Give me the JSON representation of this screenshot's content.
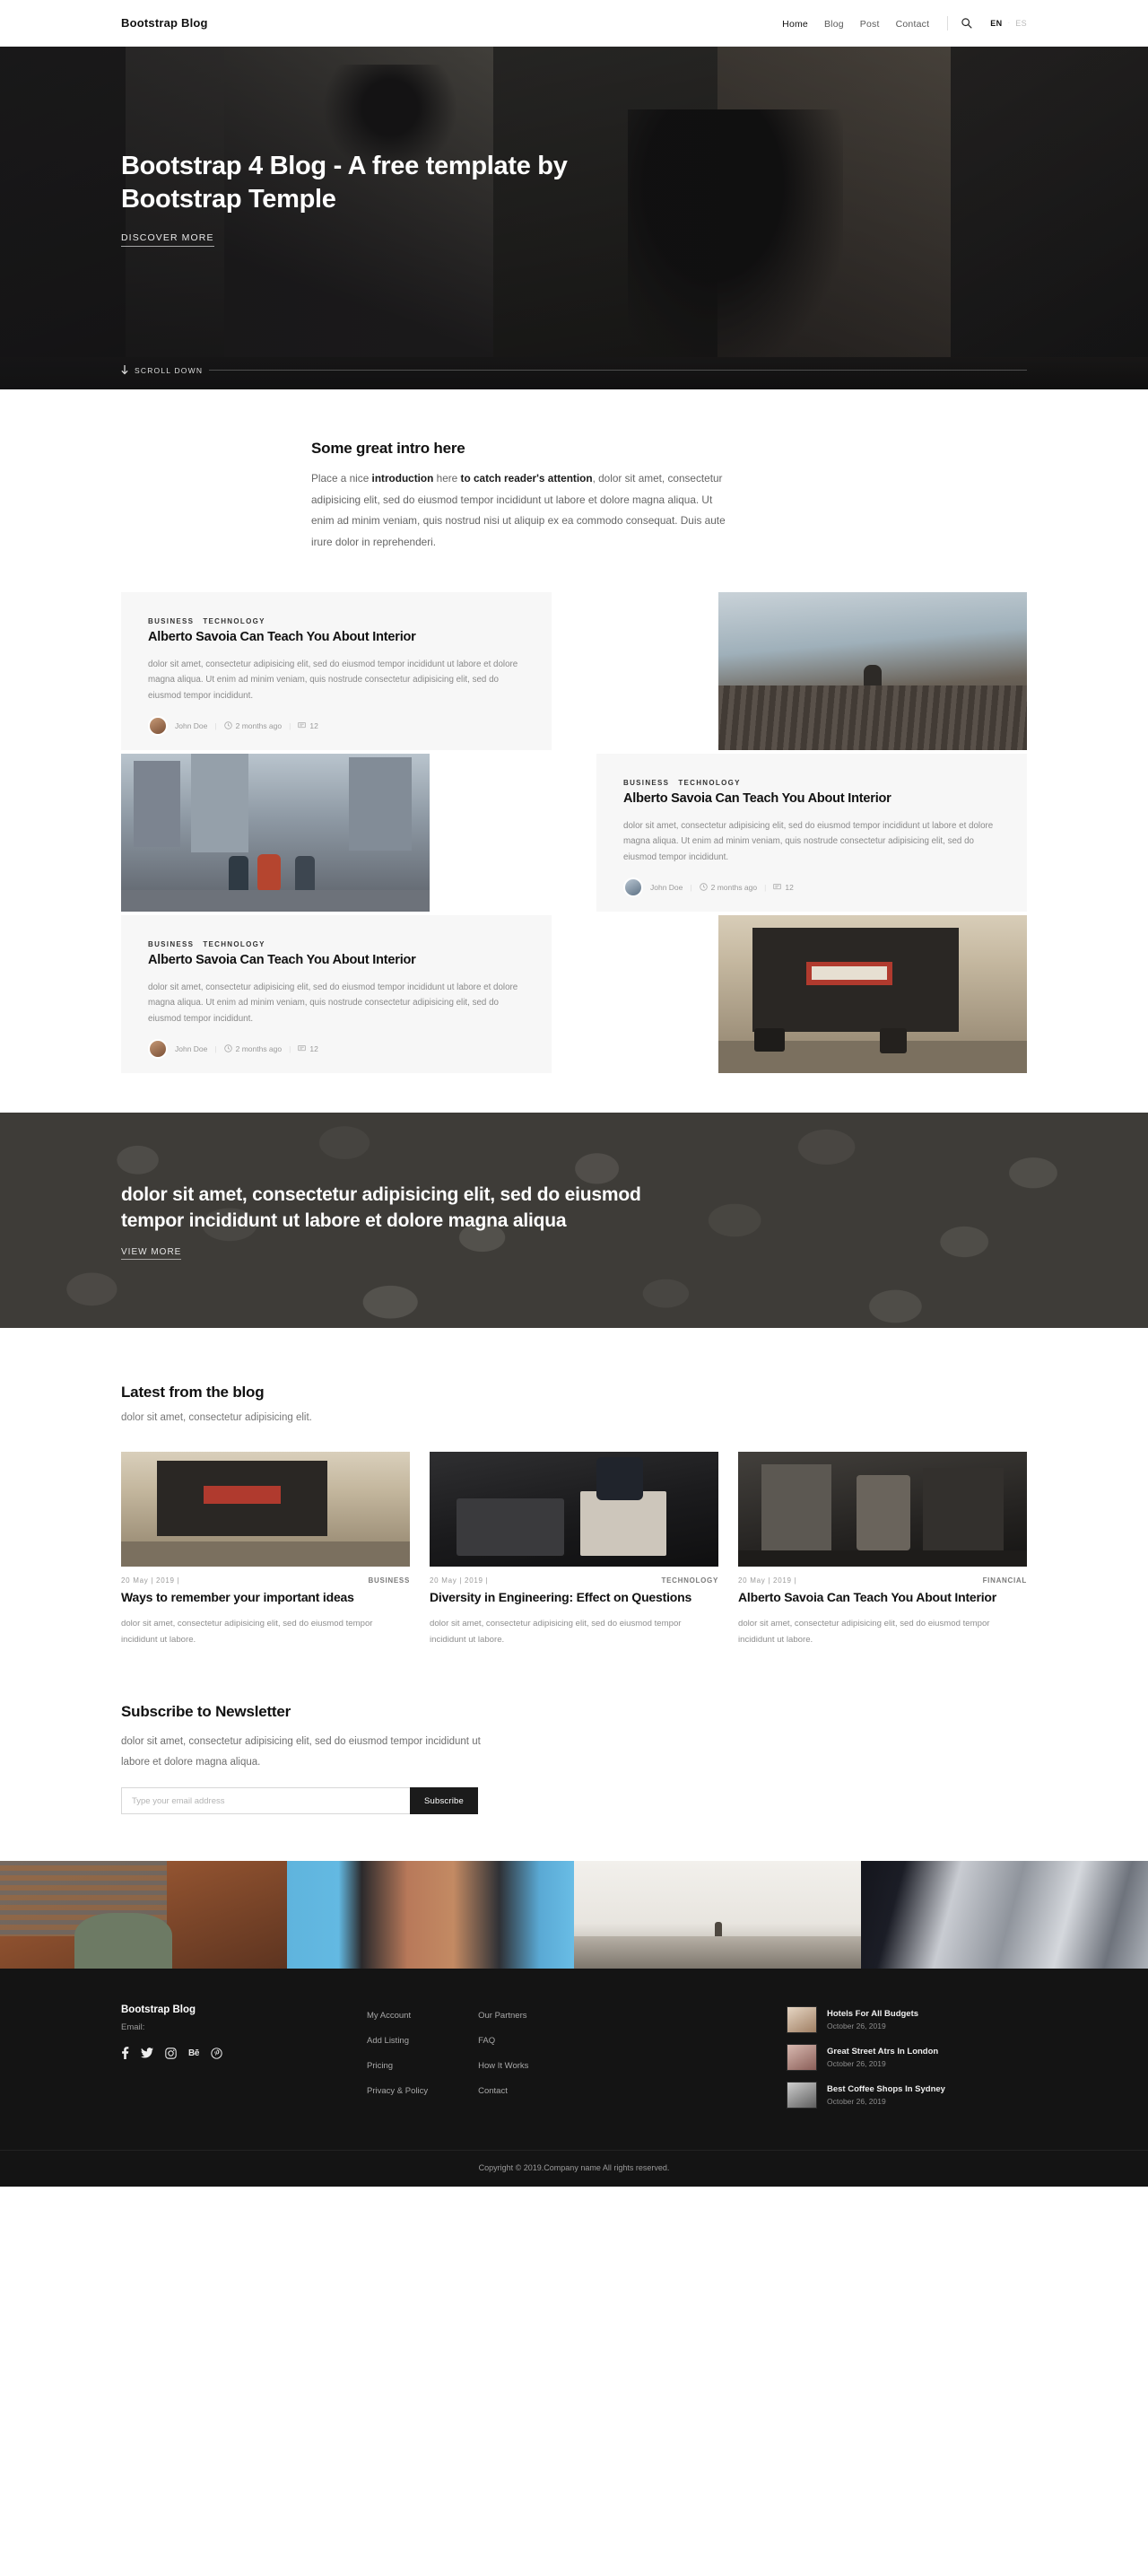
{
  "navbar": {
    "brand": "Bootstrap Blog",
    "links": [
      {
        "label": "Home",
        "active": true
      },
      {
        "label": "Blog",
        "active": false
      },
      {
        "label": "Post",
        "active": false
      },
      {
        "label": "Contact",
        "active": false
      }
    ],
    "search_icon": "search-icon",
    "lang_primary": "EN",
    "lang_secondary": "ES"
  },
  "hero": {
    "title": "Bootstrap 4 Blog - A free template by Bootstrap Temple",
    "cta_label": "DISCOVER MORE",
    "scroll_label": "SCROLL DOWN"
  },
  "intro": {
    "title": "Some great intro here",
    "p_1": "Place a nice ",
    "b_1": "introduction",
    "p_2": " here ",
    "b_2": "to catch reader's attention",
    "p_3": ", dolor sit amet, consectetur adipisicing elit, sed do eiusmod tempor incididunt ut labore et dolore magna aliqua. Ut enim ad minim veniam, quis nostrud nisi ut aliquip ex ea commodo consequat. Duis aute irure dolor in reprehenderi."
  },
  "featured": [
    {
      "cats": [
        "BUSINESS",
        "TECHNOLOGY"
      ],
      "title": "Alberto Savoia Can Teach You About Interior",
      "excerpt": "dolor sit amet, consectetur adipisicing elit, sed do eiusmod tempor incididunt ut labore et dolore magna aliqua. Ut enim ad minim veniam, quis nostrude consectetur adipisicing elit, sed do eiusmod tempor incididunt.",
      "author": "John Doe",
      "date": "2 months ago",
      "comments": "12",
      "image_align": "right"
    },
    {
      "cats": [
        "BUSINESS",
        "TECHNOLOGY"
      ],
      "title": "Alberto Savoia Can Teach You About Interior",
      "excerpt": "dolor sit amet, consectetur adipisicing elit, sed do eiusmod tempor incididunt ut labore et dolore magna aliqua. Ut enim ad minim veniam, quis nostrude consectetur adipisicing elit, sed do eiusmod tempor incididunt.",
      "author": "John Doe",
      "date": "2 months ago",
      "comments": "12",
      "image_align": "left"
    },
    {
      "cats": [
        "BUSINESS",
        "TECHNOLOGY"
      ],
      "title": "Alberto Savoia Can Teach You About Interior",
      "excerpt": "dolor sit amet, consectetur adipisicing elit, sed do eiusmod tempor incididunt ut labore et dolore magna aliqua. Ut enim ad minim veniam, quis nostrude consectetur adipisicing elit, sed do eiusmod tempor incididunt.",
      "author": "John Doe",
      "date": "2 months ago",
      "comments": "12",
      "image_align": "right"
    }
  ],
  "cta": {
    "title": "dolor sit amet, consectetur adipisicing elit, sed do eiusmod tempor incididunt ut labore et dolore magna aliqua",
    "link_label": "VIEW MORE"
  },
  "latest": {
    "title": "Latest from the blog",
    "lead": "dolor sit amet, consectetur adipisicing elit.",
    "posts": [
      {
        "date": "20 May | 2019  |",
        "category": "BUSINESS",
        "title": "Ways to remember your important ideas",
        "excerpt": "dolor sit amet, consectetur adipisicing elit, sed do eiusmod tempor incididunt ut labore."
      },
      {
        "date": "20 May | 2019  |",
        "category": "TECHNOLOGY",
        "title": "Diversity in Engineering: Effect on Questions",
        "excerpt": "dolor sit amet, consectetur adipisicing elit, sed do eiusmod tempor incididunt ut labore."
      },
      {
        "date": "20 May | 2019  |",
        "category": "FINANCIAL",
        "title": "Alberto Savoia Can Teach You About Interior",
        "excerpt": "dolor sit amet, consectetur adipisicing elit, sed do eiusmod tempor incididunt ut labore."
      }
    ]
  },
  "newsletter": {
    "title": "Subscribe to Newsletter",
    "description": "dolor sit amet, consectetur adipisicing elit, sed do eiusmod tempor incididunt ut labore et dolore magna aliqua.",
    "placeholder": "Type your email address",
    "input_value": "",
    "button_label": "Subscribe"
  },
  "footer": {
    "brand": "Bootstrap Blog",
    "email_label": "Email:",
    "socials": [
      {
        "name": "facebook-icon",
        "glyph": "f"
      },
      {
        "name": "twitter-icon",
        "glyph": "t"
      },
      {
        "name": "instagram-icon",
        "glyph": "i"
      },
      {
        "name": "behance-icon",
        "glyph": "Bē"
      },
      {
        "name": "pinterest-icon",
        "glyph": "p"
      }
    ],
    "links_col_1": [
      "My Account",
      "Add Listing",
      "Pricing",
      "Privacy & Policy"
    ],
    "links_col_2": [
      "Our Partners",
      "FAQ",
      "How It Works",
      "Contact"
    ],
    "posts": [
      {
        "title": "Hotels For All Budgets",
        "date": "October 26, 2019"
      },
      {
        "title": "Great Street Atrs In London",
        "date": "October 26, 2019"
      },
      {
        "title": "Best Coffee Shops In Sydney",
        "date": "October 26, 2019"
      }
    ],
    "copyright": "Copyright © 2019.Company name All rights reserved."
  },
  "colors": {
    "dark": "#141414",
    "accent": "#1b1b1b",
    "text": "#555555",
    "muted": "#9a9a9a"
  }
}
